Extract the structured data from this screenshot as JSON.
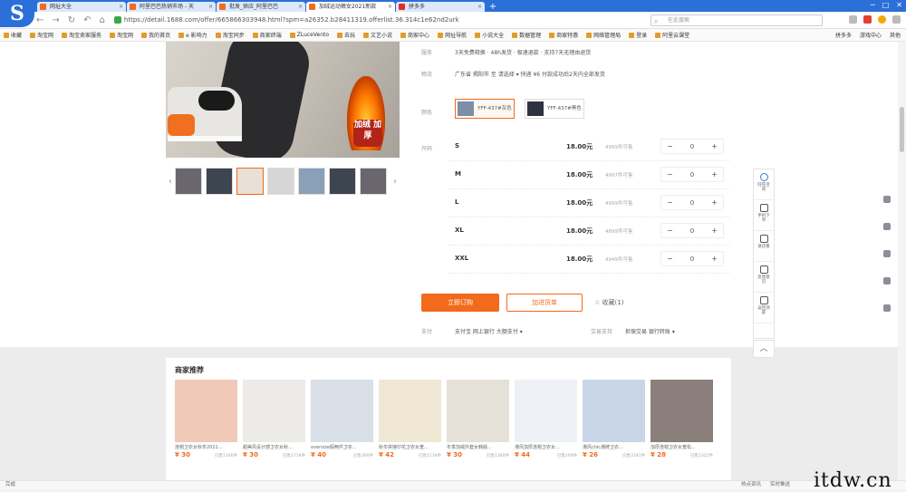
{
  "browser": {
    "tabs": [
      {
        "label": "网址大全"
      },
      {
        "label": "阿里巴巴热销市场 - 天"
      },
      {
        "label": "批发_供应_阿里巴巴"
      },
      {
        "label": "加绒运动裤女2021新款"
      },
      {
        "label": "拼多多"
      }
    ],
    "address": "https://detail.1688.com/offer/665866303948.html?spm=a26352.b28411319.offerlist.36.314c1e62nd2urk",
    "search_placeholder": "在此搜索",
    "bookmarks": [
      "收藏",
      "淘宝网",
      "淘宝卖家服务",
      "淘宝网",
      "我的首页",
      "e 影响力",
      "淘宝同步",
      "商家终端",
      "ZLuceVento",
      "去玩",
      "文艺小说",
      "商家中心",
      "网址导航",
      "小说大全",
      "数据管理",
      "商家特惠",
      "网络管理局",
      "登录",
      "阿里云课堂"
    ],
    "bookmarks_right": [
      "拼多多",
      "游戏中心",
      "其他"
    ]
  },
  "product": {
    "promo_badge": "加绒 加厚",
    "rows": {
      "service_label": "服务",
      "service_text": "3天免费释换 · 48h发货 · 极速退款 · 支持7天无理由退货",
      "shipping_label": "物流",
      "shipping_text": "广东省 揭阳市 至 请选择 ▾     快递 ¥6        付款成功后2天内全部发货",
      "color_label": "颜色",
      "size_label": "尺码",
      "pay_label": "支付",
      "pay_text": "支付宝   网上银行   大额支付 ▾",
      "trade_label": "交易支持",
      "trade_text": "担保交易   银行转账 ▾"
    },
    "colors": [
      {
        "label": "YFF-437#灰色"
      },
      {
        "label": "YFF-437#黑色"
      }
    ],
    "sizes": [
      {
        "name": "S",
        "price": "18.00元",
        "stock": "4999件可售",
        "qty": "0"
      },
      {
        "name": "M",
        "price": "18.00元",
        "stock": "4997件可售",
        "qty": "0"
      },
      {
        "name": "L",
        "price": "18.00元",
        "stock": "4999件可售",
        "qty": "0"
      },
      {
        "name": "XL",
        "price": "18.00元",
        "stock": "4899件可售",
        "qty": "0"
      },
      {
        "name": "XXL",
        "price": "18.00元",
        "stock": "4949件可售",
        "qty": "0"
      }
    ],
    "buy_label": "立即订购",
    "cart_label": "加进货单",
    "fav_label": "收藏(1)"
  },
  "float_toolbar": {
    "items": [
      "旺旺咨询",
      "手机下单",
      "进店看",
      "反馈意见",
      "返回顶部"
    ]
  },
  "recommend": {
    "title": "商家推荐",
    "items": [
      {
        "name": "连帽卫衣女秋冬2021...",
        "price": "¥ 30",
        "sold": "已售1166件"
      },
      {
        "name": "甜美风设计感卫衣女秋...",
        "price": "¥ 30",
        "sold": "已售1718件"
      },
      {
        "name": "oversize假两件卫衣...",
        "price": "¥ 40",
        "sold": "已售369件"
      },
      {
        "name": "秋冬拼接印花卫衣女宽...",
        "price": "¥ 42",
        "sold": "已售1139件"
      },
      {
        "name": "冬季加绒外套女韩版...",
        "price": "¥ 30",
        "sold": "已售1380件"
      },
      {
        "name": "港风加厚连帽卫衣女...",
        "price": "¥ 44",
        "sold": "已售209件"
      },
      {
        "name": "港风chic潮牌卫衣...",
        "price": "¥ 26",
        "sold": "已售3181件"
      },
      {
        "name": "加厚连帽卫衣女宽松...",
        "price": "¥ 28",
        "sold": "已售1322件"
      }
    ]
  },
  "status": {
    "left": "完成",
    "right": [
      "热点资讯",
      "实时推送"
    ]
  },
  "watermark": "itdw.cn"
}
